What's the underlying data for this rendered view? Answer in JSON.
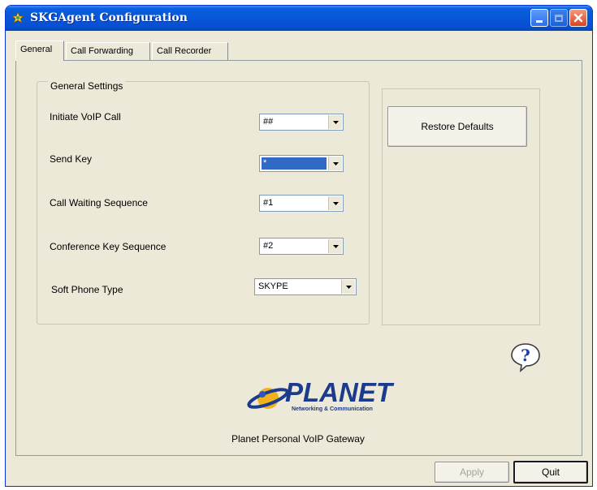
{
  "window": {
    "title": "SKGAgent Configuration"
  },
  "tabs": [
    {
      "label": "General",
      "active": true
    },
    {
      "label": "Call Forwarding",
      "active": false
    },
    {
      "label": "Call Recorder",
      "active": false
    }
  ],
  "general_settings": {
    "legend": "General Settings",
    "initiate_voip_call": {
      "label": "Initiate VoIP Call",
      "value": "##"
    },
    "send_key": {
      "label": "Send Key",
      "value": "*"
    },
    "call_waiting_sequence": {
      "label": "Call Waiting Sequence",
      "value": "#1"
    },
    "conference_key_sequence": {
      "label": "Conference Key Sequence",
      "value": "#2"
    },
    "soft_phone_type": {
      "label": "Soft Phone Type",
      "value": "SKYPE"
    }
  },
  "buttons": {
    "restore_defaults": "Restore Defaults",
    "help": "?",
    "apply": "Apply",
    "quit": "Quit"
  },
  "branding": {
    "logo_word": "PLANET",
    "logo_tagline": "Networking & Communication",
    "product_name": "Planet Personal VoIP Gateway"
  },
  "colors": {
    "titlebar": "#0856d9",
    "selection": "#316ac5",
    "logo_blue": "#1c3b8c",
    "face": "#ece9d8"
  }
}
